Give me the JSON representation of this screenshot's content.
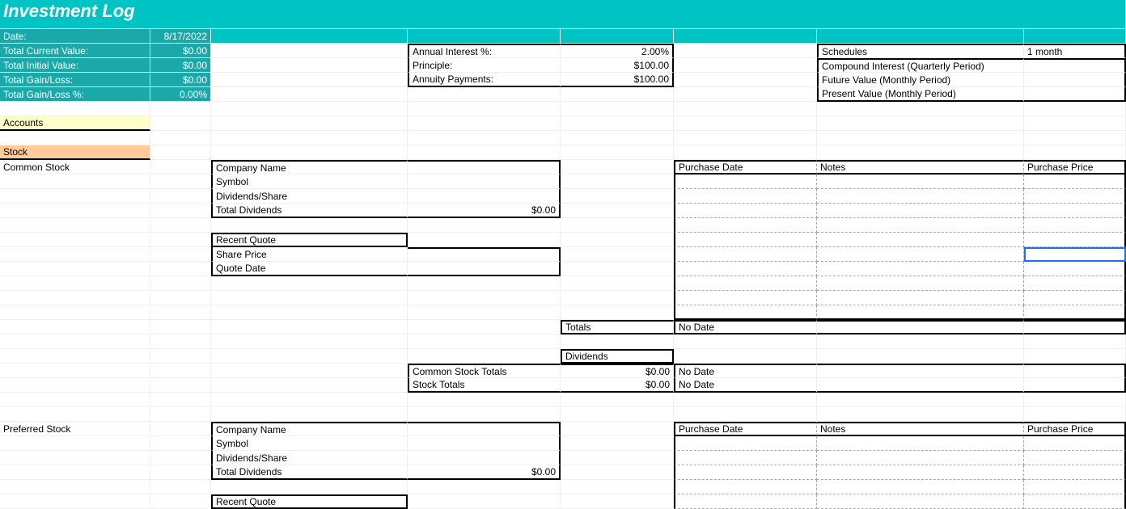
{
  "title": "Investment Log",
  "summary": {
    "date_label": "Date:",
    "date_value": "8/17/2022",
    "tcv_label": "Total Current Value:",
    "tcv_value": "$0.00",
    "tiv_label": "Total Initial Value:",
    "tiv_value": "$0.00",
    "tgl_label": "Total Gain/Loss:",
    "tgl_value": "$0.00",
    "tglp_label": "Total Gain/Loss %:",
    "tglp_value": "0.00%"
  },
  "calc": {
    "air_label": "Annual Interest %:",
    "air_value": "2.00%",
    "prin_label": "Principle:",
    "prin_value": "$100.00",
    "ann_label": "Annuity Payments:",
    "ann_value": "$100.00"
  },
  "schedules": {
    "header": "Schedules",
    "period": "1 month",
    "r1": "Compound Interest (Quarterly Period)",
    "r2": "Future Value (Monthly Period)",
    "r3": "Present Value (Monthly Period)"
  },
  "sections": {
    "accounts": "Accounts",
    "stock": "Stock",
    "common_stock": "Common Stock",
    "preferred_stock": "Preferred Stock"
  },
  "stock_block": {
    "company": "Company Name",
    "symbol": "Symbol",
    "divshare": "Dividends/Share",
    "totdiv": "Total Dividends",
    "totdiv_val": "$0.00",
    "recent_quote": "Recent Quote",
    "share_price": "Share Price",
    "quote_date": "Quote Date"
  },
  "headers": {
    "purchase_date": "Purchase Date",
    "notes": "Notes",
    "purchase_price": "Purchase Price"
  },
  "totals": {
    "totals": "Totals",
    "no_date": "No Date",
    "dividends": "Dividends",
    "cs_totals": "Common Stock Totals",
    "cs_val": "$0.00",
    "st_totals": "Stock Totals",
    "st_val": "$0.00"
  }
}
